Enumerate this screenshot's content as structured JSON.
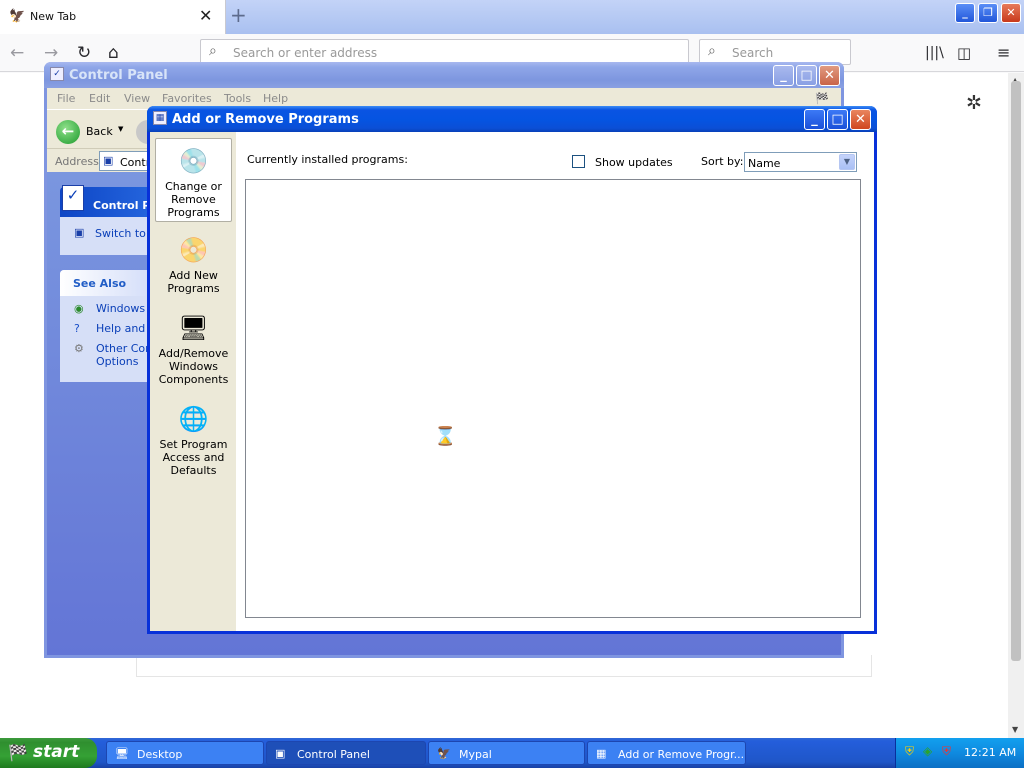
{
  "browser": {
    "tab_title": "New Tab",
    "tab_favicon": "mypal-icon",
    "url_placeholder": "Search or enter address",
    "search_placeholder": "Search",
    "window_controls": {
      "minimize": "_",
      "restore": "❐",
      "close": "✕"
    }
  },
  "control_panel": {
    "title": "Control Panel",
    "menu": [
      "File",
      "Edit",
      "View",
      "Favorites",
      "Tools",
      "Help"
    ],
    "back_label": "Back",
    "address_label": "Address",
    "address_value": "Contr",
    "panel_title": "Control Pa",
    "switch_link": "Switch to C",
    "see_also_title": "See Also",
    "see_also": [
      {
        "label": "Windows U",
        "icon": "globe-icon"
      },
      {
        "label": "Help and S",
        "icon": "help-icon"
      },
      {
        "label": "Other Cont\nOptions",
        "icon": "gear-icon"
      }
    ]
  },
  "add_remove": {
    "title": "Add or Remove Programs",
    "sidebar": [
      {
        "label": "Change or Remove Programs",
        "icon": "change-programs-icon",
        "selected": true
      },
      {
        "label": "Add New Programs",
        "icon": "add-programs-icon",
        "selected": false
      },
      {
        "label": "Add/Remove Windows Components",
        "icon": "windows-components-icon",
        "selected": false
      },
      {
        "label": "Set Program Access and Defaults",
        "icon": "program-defaults-icon",
        "selected": false
      }
    ],
    "currently_installed": "Currently installed programs:",
    "show_updates": "Show updates",
    "show_updates_checked": false,
    "sort_by_label": "Sort by:",
    "sort_by_value": "Name"
  },
  "taskbar": {
    "start_label": "start",
    "tasks": [
      {
        "label": "Desktop",
        "icon": "desktop-icon",
        "active": false
      },
      {
        "label": "Control Panel",
        "icon": "control-panel-icon",
        "active": true
      },
      {
        "label": "Mypal",
        "icon": "mypal-icon",
        "active": false
      },
      {
        "label": "Add or Remove Progr...",
        "icon": "add-remove-icon",
        "active": false
      }
    ],
    "clock": "12:21 AM"
  },
  "colors": {
    "xp_title_blue": "#0554e1",
    "xp_face": "#ece9d8",
    "taskbar_blue": "#245edb",
    "start_green": "#35a135",
    "tray_blue": "#0f8ae0"
  }
}
